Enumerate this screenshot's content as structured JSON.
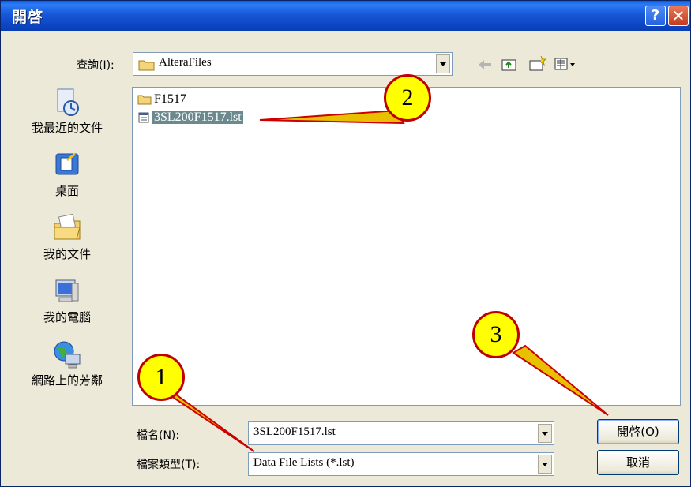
{
  "window": {
    "title": "開啓"
  },
  "titlebar_buttons": {
    "help": "?",
    "close": "✕"
  },
  "lookin": {
    "label": "查詢(I):",
    "value": "AlteraFiles"
  },
  "places": [
    {
      "label": "我最近的文件",
      "icon": "recent-documents-icon"
    },
    {
      "label": "桌面",
      "icon": "desktop-icon"
    },
    {
      "label": "我的文件",
      "icon": "my-documents-icon"
    },
    {
      "label": "我的電腦",
      "icon": "my-computer-icon"
    },
    {
      "label": "網路上的芳鄰",
      "icon": "network-places-icon"
    }
  ],
  "files": [
    {
      "name": "F1517",
      "type": "folder"
    },
    {
      "name": "3SL200F1517.lst",
      "type": "file",
      "selected": true
    }
  ],
  "filename": {
    "label": "檔名(N):",
    "value": "3SL200F1517.lst"
  },
  "filetype": {
    "label": "檔案類型(T):",
    "value": "Data File Lists (*.lst)"
  },
  "buttons": {
    "open": "開啓(O)",
    "cancel": "取消"
  },
  "callouts": [
    "1",
    "2",
    "3"
  ],
  "colors": {
    "callout_fill": "#ffff00",
    "callout_border": "#c00000",
    "arrow": "#cc0000",
    "titlebar": "#0a46c4"
  }
}
